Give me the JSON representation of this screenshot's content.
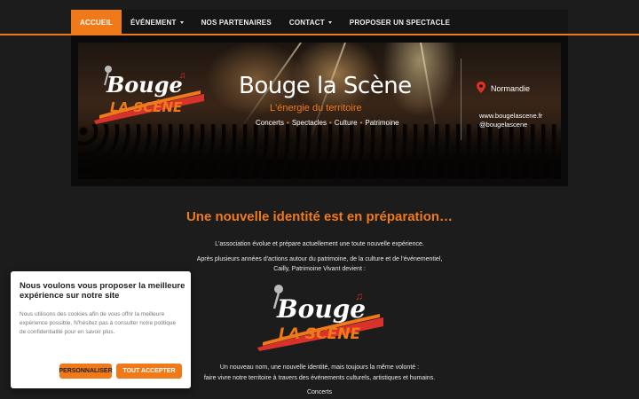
{
  "nav": {
    "items": [
      {
        "label": "ACCUEIL",
        "active": true,
        "dropdown": false
      },
      {
        "label": "ÉVÉNEMENT",
        "active": false,
        "dropdown": true
      },
      {
        "label": "NOS PARTENAIRES",
        "active": false,
        "dropdown": false
      },
      {
        "label": "CONTACT",
        "active": false,
        "dropdown": true
      },
      {
        "label": "PROPOSER UN SPECTACLE",
        "active": false,
        "dropdown": false
      }
    ]
  },
  "banner": {
    "logo_line1": "Bouge",
    "logo_line2": "LA SCÈNE",
    "title": "Bouge la Scène",
    "tagline": "L'énergie du territoire",
    "categories": [
      "Concerts",
      "Spectacles",
      "Culture",
      "Patrimoine"
    ],
    "location": "Normandie",
    "website": "www.bougelascene.fr",
    "social": "@bougelascene"
  },
  "content": {
    "heading": "Une nouvelle identité est en préparation…",
    "intro": "L'association évolue et prépare actuellement une toute nouvelle expérience.",
    "history_line1": "Après plusieurs années d'actions autour du patrimoine, de la culture et de l'événementiel,",
    "history_line2": "Cailly, Patrimoine Vivant devient :",
    "logo_line1": "Bouge",
    "logo_line2": "LA SCÈNE",
    "closing_line1": "Un nouveau nom, une nouvelle identité, mais toujours la même volonté :",
    "closing_line2": "faire vivre notre territoire à travers des événements culturels, artistiques et humains.",
    "list_first": "Concerts"
  },
  "cookie": {
    "title": "Nous voulons vous proposer la meilleure expérience sur notre site",
    "text": "Nous utilisons des cookies afin de vous offrir la meilleure expérience possible. N'hésitez pas à consulter notre politique de confidentialité pour en savoir plus.",
    "customize_label": "PERSONNALISER",
    "accept_label": "TOUT ACCEPTER"
  },
  "colors": {
    "accent": "#f07a1a",
    "background": "#1c1c1c",
    "nav": "#151515",
    "logo_red": "#d8322a"
  }
}
